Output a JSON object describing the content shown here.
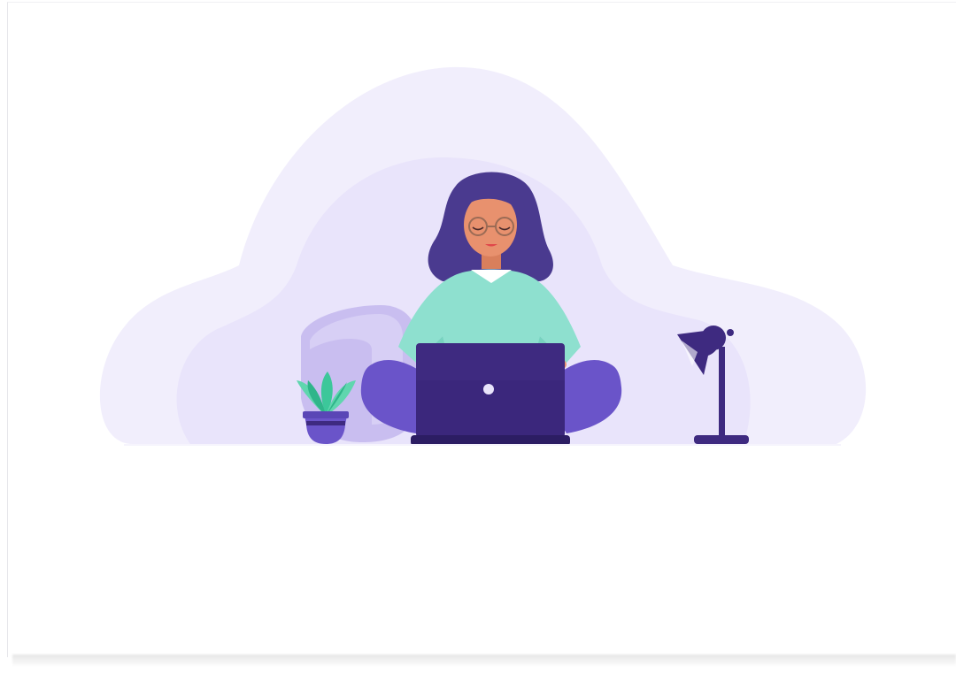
{
  "illustration": {
    "subject": "woman-working-on-laptop-illustration",
    "colors": {
      "cloud_outer": "#f1eefc",
      "cloud_inner": "#e7e2fa",
      "hair": "#4a3a8f",
      "skin": "#e8916e",
      "sweater": "#8ee0cf",
      "sweater_shade": "#78d3c0",
      "pants": "#6a54c9",
      "laptop": "#3e2a80",
      "laptop_base": "#2c1d63",
      "pillow": "#c9bef0",
      "plant_leaf": "#3cc79a",
      "plant_pot": "#6a54c9",
      "lamp": "#3e2a80"
    }
  }
}
